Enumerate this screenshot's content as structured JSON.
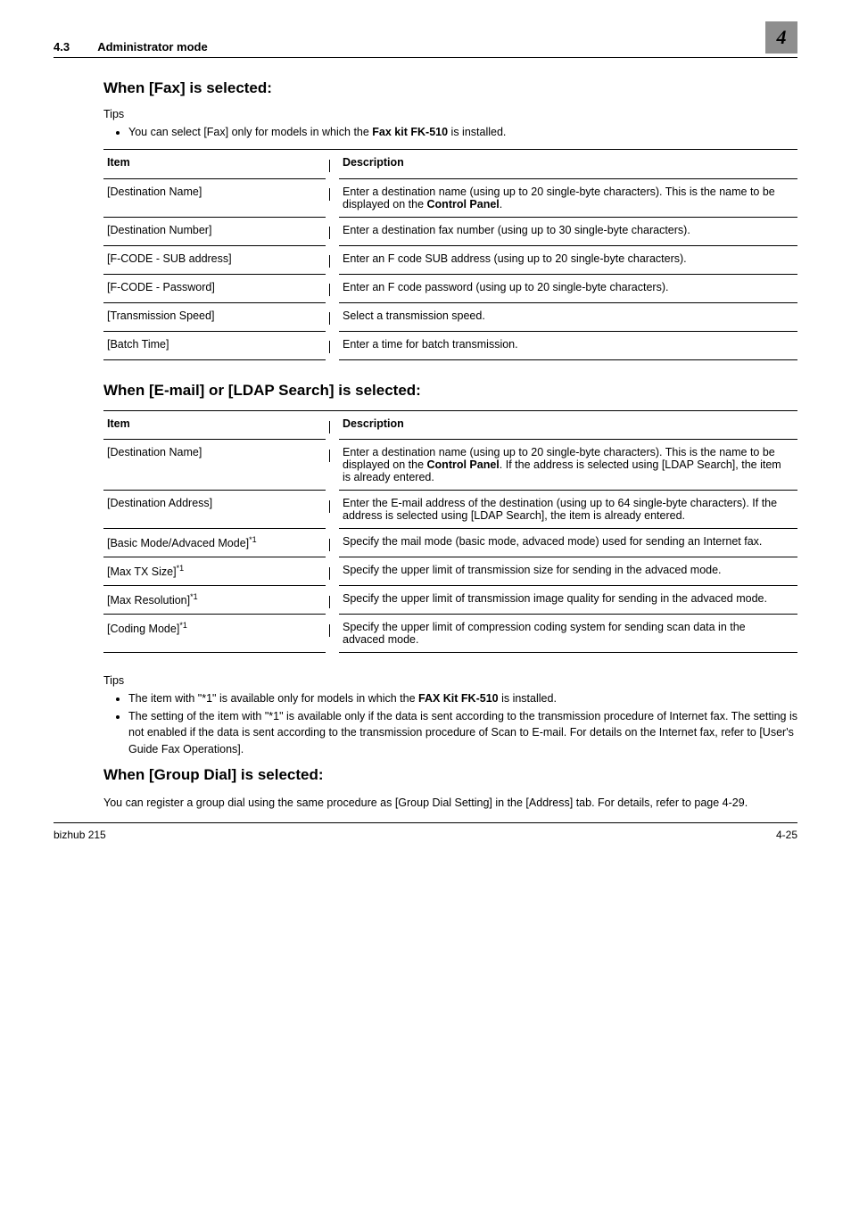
{
  "header": {
    "section_number": "4.3",
    "section_title": "Administrator mode",
    "chapter_number": "4"
  },
  "fax_section": {
    "heading": "When [Fax] is selected:",
    "tips_label": "Tips",
    "tip_prefix": "You can select [Fax] only for models in which the ",
    "tip_bold": "Fax kit FK-510",
    "tip_suffix": " is installed.",
    "col_item": "Item",
    "col_desc": "Description",
    "rows": [
      {
        "item": "[Destination Name]",
        "desc_pre": "Enter a destination name (using up to 20 single-byte characters). This is the name to be displayed on the ",
        "desc_bold": "Control Panel",
        "desc_post": "."
      },
      {
        "item": "[Destination Number]",
        "desc_pre": "Enter a destination fax number (using up to 30 single-byte characters).",
        "desc_bold": "",
        "desc_post": ""
      },
      {
        "item": "[F-CODE - SUB address]",
        "desc_pre": "Enter an F code SUB address (using up to 20 single-byte characters).",
        "desc_bold": "",
        "desc_post": ""
      },
      {
        "item": "[F-CODE - Password]",
        "desc_pre": "Enter an F code password (using up to 20 single-byte characters).",
        "desc_bold": "",
        "desc_post": ""
      },
      {
        "item": "[Transmission Speed]",
        "desc_pre": "Select a transmission speed.",
        "desc_bold": "",
        "desc_post": ""
      },
      {
        "item": "[Batch Time]",
        "desc_pre": "Enter a time for batch transmission.",
        "desc_bold": "",
        "desc_post": ""
      }
    ]
  },
  "email_section": {
    "heading": "When [E-mail] or [LDAP Search] is selected:",
    "col_item": "Item",
    "col_desc": "Description",
    "rows": [
      {
        "item": "[Destination Name]",
        "sup": "",
        "desc_pre": "Enter a destination name (using up to 20 single-byte characters). This is the name to be displayed on the ",
        "desc_bold": "Control Panel",
        "desc_post": ". If the address is selected using [LDAP Search], the item is already entered."
      },
      {
        "item": "[Destination Address]",
        "sup": "",
        "desc_pre": "Enter the E-mail address of the destination (using up to 64 single-byte characters). If the address is selected using [LDAP Search], the item is already entered.",
        "desc_bold": "",
        "desc_post": ""
      },
      {
        "item": "[Basic Mode/Advaced Mode]",
        "sup": "*1",
        "desc_pre": "Specify the mail mode (basic mode, advaced mode) used for sending an Internet fax.",
        "desc_bold": "",
        "desc_post": ""
      },
      {
        "item": "[Max TX Size]",
        "sup": "*1",
        "desc_pre": "Specify the upper limit of transmission size for sending in the advaced mode.",
        "desc_bold": "",
        "desc_post": ""
      },
      {
        "item": "[Max Resolution]",
        "sup": "*1",
        "desc_pre": "Specify the upper limit of transmission image quality for sending in the advaced mode.",
        "desc_bold": "",
        "desc_post": ""
      },
      {
        "item": "[Coding Mode]",
        "sup": "*1",
        "desc_pre": "Specify the upper limit of compression coding system for sending scan data in the advaced mode.",
        "desc_bold": "",
        "desc_post": ""
      }
    ],
    "tips_label": "Tips",
    "tip1_pre": "The item with \"*1\" is available only for models in which the ",
    "tip1_bold": "FAX Kit FK-510",
    "tip1_post": " is installed.",
    "tip2": "The setting of the item with \"*1\" is available only if the data is sent according to the transmission procedure of Internet fax. The setting is not enabled if the data is sent according to the transmission procedure of Scan to E-mail. For details on the Internet fax, refer to [User's Guide Fax Operations]."
  },
  "group_section": {
    "heading": "When [Group Dial] is selected:",
    "body": "You can register a group dial using the same procedure as [Group Dial Setting] in the [Address] tab. For details, refer to page 4-29."
  },
  "footer": {
    "left": "bizhub 215",
    "right": "4-25"
  }
}
